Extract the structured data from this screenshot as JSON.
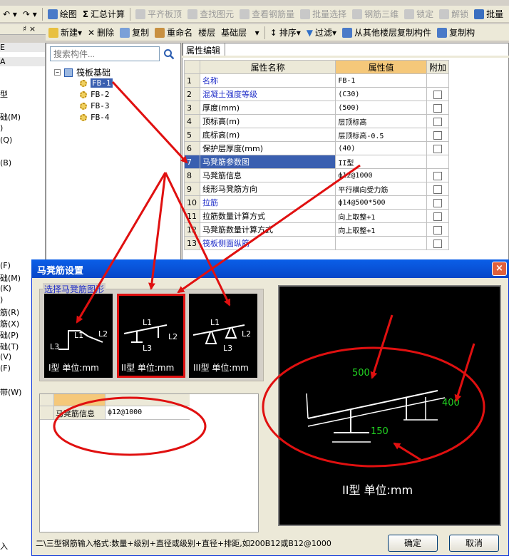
{
  "toolbar1": {
    "items": [
      "绘图",
      "汇总计算",
      "平齐板顶",
      "查找图元",
      "查看钢筋量",
      "批量选择",
      "钢筋三维",
      "锁定",
      "解锁",
      "批量"
    ]
  },
  "toolbar2": {
    "items": [
      "新建",
      "删除",
      "复制",
      "重命名",
      "楼层",
      "基础层",
      "排序",
      "过滤",
      "从其他楼层复制构件",
      "复制构"
    ]
  },
  "left_strip": {
    "pin": "♯ ×",
    "rows": [
      "E",
      "A",
      "型",
      "础(M)",
      ")",
      "(Q)",
      "(B)",
      "(F)",
      "础(M)",
      "(K)",
      ")",
      "筋(R)",
      "筋(X)",
      "础(P)",
      "础(T)",
      "(V)",
      "(F)",
      "带(W)",
      "入"
    ]
  },
  "tree": {
    "search_placeholder": "搜索构件...",
    "root": "筏板基础",
    "children": [
      "FB-1",
      "FB-2",
      "FB-3",
      "FB-4"
    ]
  },
  "property_grid": {
    "tab": "属性编辑",
    "headers": [
      "属性名称",
      "属性值",
      "附加"
    ],
    "rows": [
      {
        "num": "1",
        "name": "名称",
        "value": "FB-1",
        "check": false
      },
      {
        "num": "2",
        "name": "混凝土强度等级",
        "value": "(C30)",
        "check": true
      },
      {
        "num": "3",
        "name": "厚度(mm)",
        "value": "(500)",
        "check": true
      },
      {
        "num": "4",
        "name": "顶标高(m)",
        "value": "层顶标高",
        "check": true
      },
      {
        "num": "5",
        "name": "底标高(m)",
        "value": "层顶标高-0.5",
        "check": true
      },
      {
        "num": "6",
        "name": "保护层厚度(mm)",
        "value": "(40)",
        "check": true
      },
      {
        "num": "7",
        "name": "马凳筋参数图",
        "value": "II型",
        "check": false
      },
      {
        "num": "8",
        "name": "马凳筋信息",
        "value": "ф12@1000",
        "check": true
      },
      {
        "num": "9",
        "name": "线形马凳筋方向",
        "value": "平行横向受力筋",
        "check": true
      },
      {
        "num": "10",
        "name": "拉筋",
        "value": "ф14@500*500",
        "check": true
      },
      {
        "num": "11",
        "name": "拉筋数量计算方式",
        "value": "向上取整+1",
        "check": true
      },
      {
        "num": "12",
        "name": "马凳筋数量计算方式",
        "value": "向上取整+1",
        "check": true
      },
      {
        "num": "13",
        "name": "筏板侧面纵筋",
        "value": "",
        "check": true
      }
    ]
  },
  "dialog": {
    "title": "马凳筋设置",
    "close": "×",
    "group_label": "选择马凳筋图形",
    "shapes": [
      {
        "caption": "I型 单位:mm",
        "labels": [
          "L1",
          "L2",
          "L3"
        ]
      },
      {
        "caption": "II型 单位:mm",
        "labels": [
          "L1",
          "L2",
          "L3"
        ]
      },
      {
        "caption": "III型 单位:mm",
        "labels": [
          "L1",
          "L2",
          "L3"
        ]
      }
    ],
    "preview": {
      "dim_top": "500",
      "dim_right": "400",
      "dim_bottom": "150",
      "caption": "II型 单位:mm"
    },
    "small_grid": {
      "row_name": "马凳筋信息",
      "row_value": "ф12@1000"
    },
    "hint": "二\\三型钢筋输入格式:数量+级别+直径或级别+直径+排距,如200B12或B12@1000",
    "ok": "确定",
    "cancel": "取消"
  },
  "colors": {
    "accent": "#0a5fe8",
    "annotation": "#e01010",
    "dimension": "#22d522"
  }
}
